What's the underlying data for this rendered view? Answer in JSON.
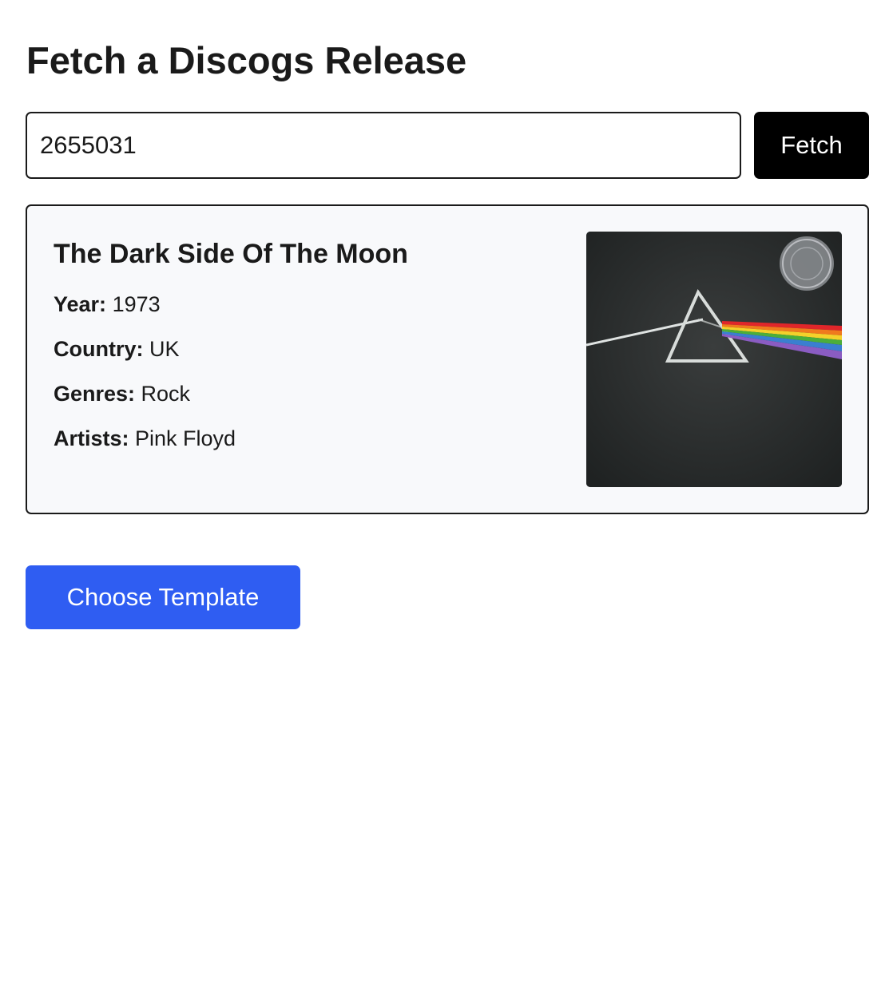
{
  "page": {
    "title": "Fetch a Discogs Release"
  },
  "search": {
    "value": "2655031",
    "button_label": "Fetch"
  },
  "release": {
    "title": "The Dark Side Of The Moon",
    "fields": {
      "year_label": "Year:",
      "year_value": "1973",
      "country_label": "Country:",
      "country_value": "UK",
      "genres_label": "Genres:",
      "genres_value": "Rock",
      "artists_label": "Artists:",
      "artists_value": "Pink Floyd"
    },
    "cover_icon": "album-cover-image"
  },
  "actions": {
    "choose_template_label": "Choose Template"
  },
  "colors": {
    "primary_button": "#2f5df2",
    "fetch_button": "#000000",
    "card_background": "#f8f9fb"
  }
}
